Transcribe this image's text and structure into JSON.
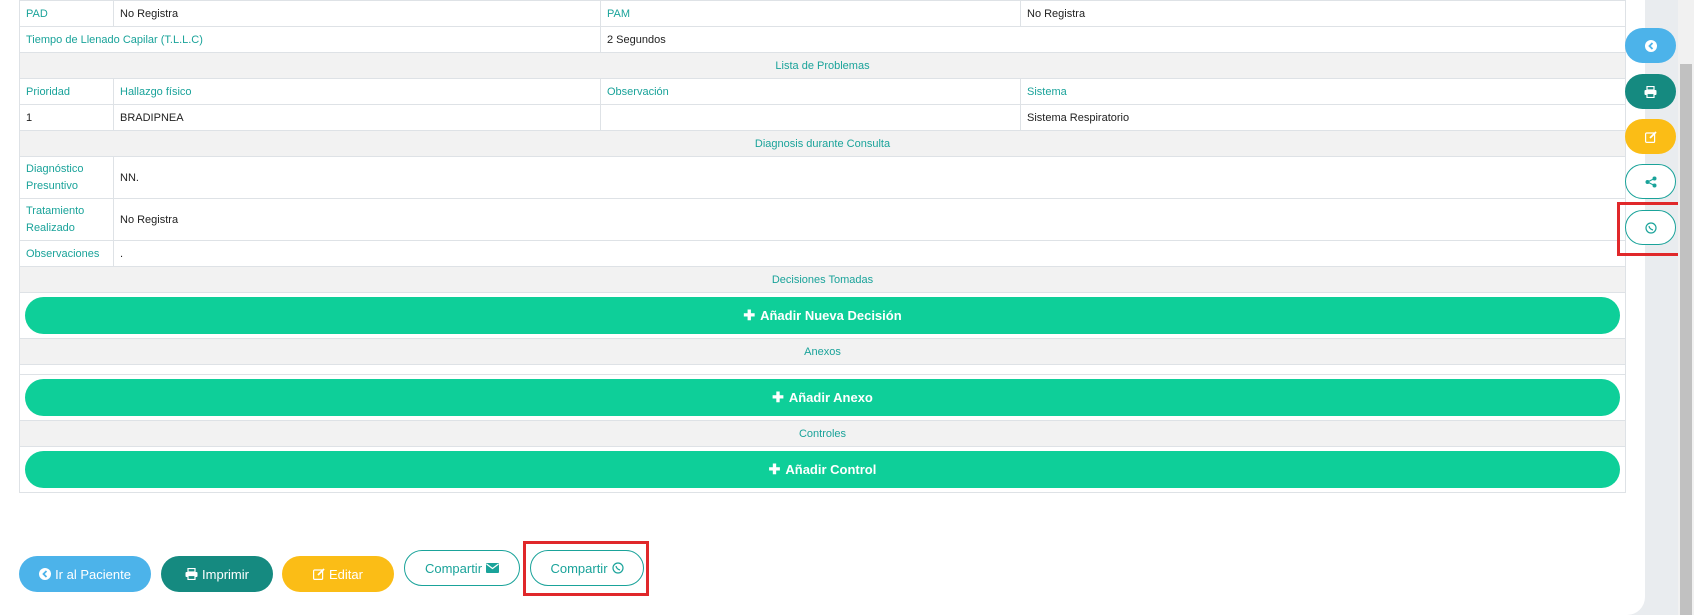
{
  "record": {
    "pad_label": "PAD",
    "pad_value": "No Registra",
    "pam_label": "PAM",
    "pam_value": "No Registra",
    "tllc_label": "Tiempo de Llenado Capilar (T.L.L.C)",
    "tllc_value": "2 Segundos",
    "problems_header": "Lista de Problemas",
    "problems_columns": [
      "Prioridad",
      "Hallazgo físico",
      "Observación",
      "Sistema"
    ],
    "problems_rows": [
      {
        "priority": "1",
        "finding": "BRADIPNEA",
        "observation": "",
        "system": "Sistema Respiratorio"
      }
    ],
    "diagnosis_header": "Diagnosis durante Consulta",
    "diag_presuntivo_label_1": "Diagnóstico",
    "diag_presuntivo_label_2": "Presuntivo",
    "diag_presuntivo_value": "NN.",
    "tratamiento_label_1": "Tratamiento",
    "tratamiento_label_2": "Realizado",
    "tratamiento_value": "No Registra",
    "observaciones_label": "Observaciones",
    "observaciones_value": ".",
    "decisions_header": "Decisiones Tomadas",
    "add_decision_label": "Añadir Nueva Decisión",
    "annexes_header": "Anexos",
    "add_annex_label": "Añadir Anexo",
    "controls_header": "Controles",
    "add_control_label": "Añadir Control"
  },
  "footer_buttons": {
    "back_label": "Ir al Paciente",
    "print_label": "Imprimir",
    "edit_label": "Editar",
    "share_email_label": "Compartir",
    "share_whatsapp_label": "Compartir"
  },
  "floating_actions": [
    "arrow-circle-left-icon",
    "print-icon",
    "edit-icon",
    "share-icon",
    "whatsapp-icon"
  ],
  "colors": {
    "accent_teal": "#1aa39a",
    "green": "#0ecf99",
    "blue": "#4cb3ea",
    "dark_teal": "#158a80",
    "yellow": "#fbbd16",
    "highlight_red": "#e0282a"
  }
}
